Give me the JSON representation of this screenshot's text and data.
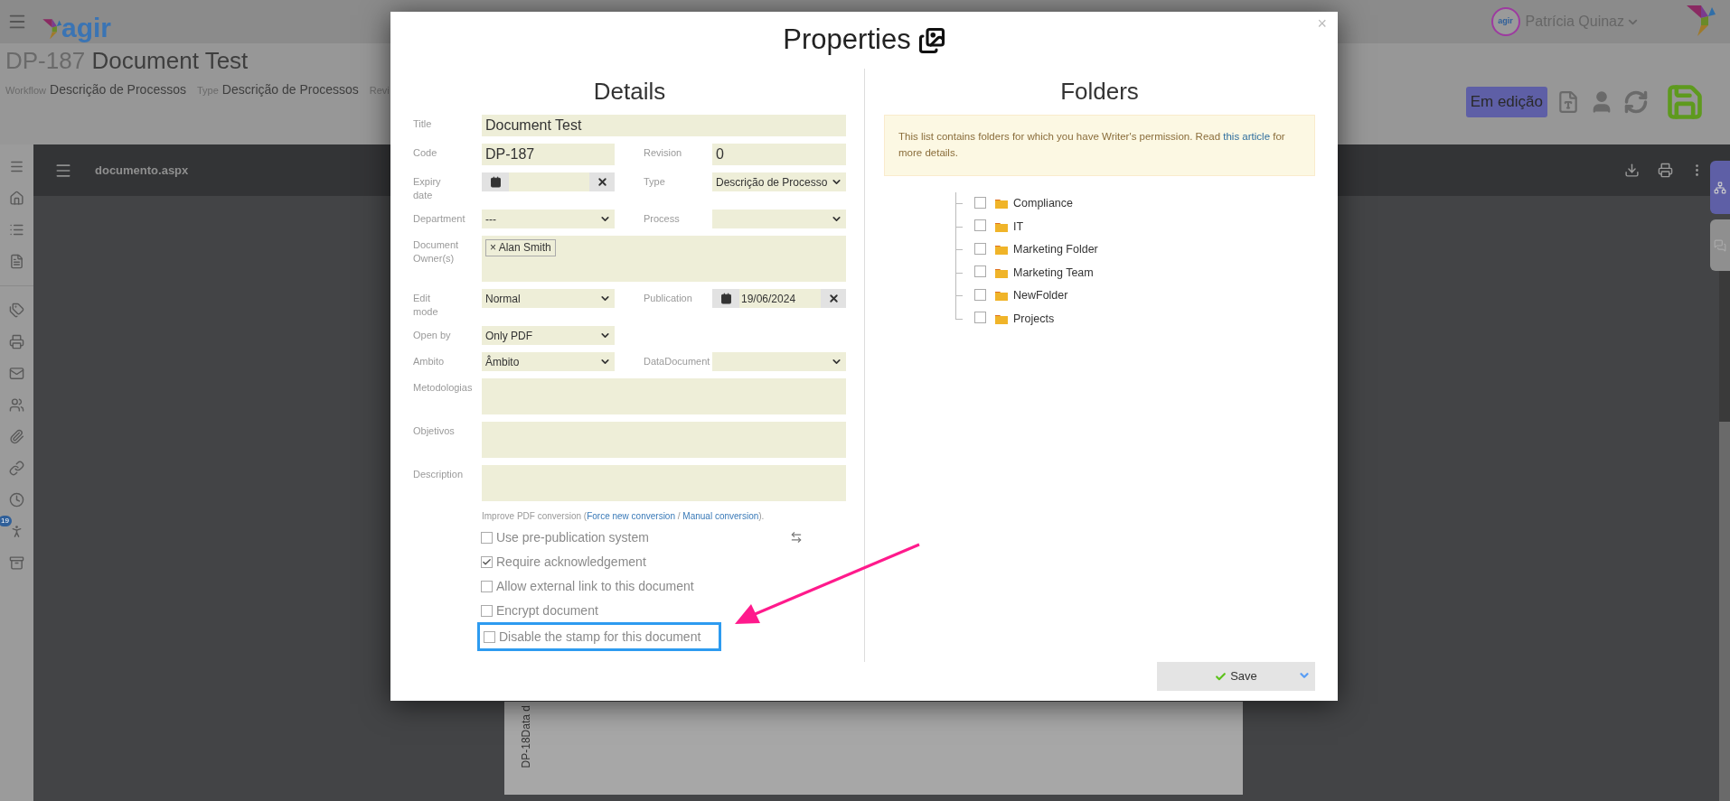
{
  "app_header": {
    "logo_text": "agir",
    "avatar_text": "agir",
    "user_name": "Patrícia Quinaz"
  },
  "document_header": {
    "code": "DP-187",
    "title": "Document Test",
    "meta": [
      {
        "label": "Workflow",
        "value": "Descrição de Processos"
      },
      {
        "label": "Type",
        "value": "Descrição de Processos"
      },
      {
        "label": "Revi"
      }
    ],
    "status_badge": "Em edição"
  },
  "sidebar": {
    "badge": "19"
  },
  "viewer": {
    "file_name": "documento.aspx",
    "page_lines": [
      "DP-18",
      "Data d"
    ]
  },
  "dialog": {
    "title": "Properties",
    "close": "×",
    "details": {
      "heading": "Details",
      "rows": [
        [
          {
            "label_lines": [
              "Title"
            ],
            "kind": "text",
            "value": "Document Test"
          }
        ],
        [
          {
            "label_lines": [
              "Code"
            ],
            "kind": "text",
            "value": "DP-187"
          },
          {
            "label_lines": [
              "Revision"
            ],
            "kind": "text",
            "value": "0"
          }
        ],
        [
          {
            "label_lines": [
              "Expiry",
              "date"
            ],
            "kind": "date"
          },
          {
            "label_lines": [
              "Type"
            ],
            "kind": "select",
            "value": "Descrição de Processo"
          }
        ],
        [
          {
            "label_lines": [
              "Department"
            ],
            "kind": "select",
            "value": "---"
          },
          {
            "label_lines": [
              "Process"
            ],
            "kind": "select"
          }
        ],
        [
          {
            "label_lines": [
              "Document",
              "Owner(s)"
            ],
            "kind": "tags",
            "tags": [
              {
                "remove": "×",
                "name": "Alan Smith"
              }
            ]
          }
        ],
        [
          {
            "label_lines": [
              "Edit",
              "mode"
            ],
            "kind": "select",
            "value": "Normal"
          },
          {
            "label_lines": [
              "Publication"
            ],
            "kind": "date",
            "value": "19/06/2024"
          }
        ],
        [
          {
            "label_lines": [
              "Open by"
            ],
            "kind": "select",
            "value": "Only PDF"
          }
        ],
        [
          {
            "label_lines": [
              "Ambito"
            ],
            "kind": "select",
            "value": "Âmbito"
          },
          {
            "label_lines": [
              "DataDocument"
            ],
            "kind": "select"
          }
        ],
        [
          {
            "label_lines": [
              "Metodologias"
            ],
            "kind": "textarea"
          }
        ],
        [
          {
            "label_lines": [
              "Objetivos"
            ],
            "kind": "textarea"
          }
        ],
        [
          {
            "label_lines": [
              "Description"
            ],
            "kind": "textarea"
          }
        ]
      ],
      "pdf_note": {
        "prefix": "Improve PDF conversion (",
        "link_1": "Force new conversion",
        "separator": " / ",
        "link_2": "Manual conversion",
        "suffix": ")."
      },
      "options": [
        {
          "label": "Use pre-publication system",
          "checked": false,
          "highlighted": false
        },
        {
          "label": "Require acknowledgement",
          "checked": true,
          "highlighted": false
        },
        {
          "label": "Allow external link to this document",
          "checked": false,
          "highlighted": false
        },
        {
          "label": "Encrypt document",
          "checked": false,
          "highlighted": false
        },
        {
          "label": "Disable the stamp for this document",
          "checked": false,
          "highlighted": true
        }
      ]
    },
    "folders": {
      "heading": "Folders",
      "notice": {
        "prefix": "This list contains folders for which you have Writer's permission. Read ",
        "link": "this article",
        "suffix": " for more details."
      },
      "items": [
        {
          "name": "Compliance",
          "checked": false
        },
        {
          "name": "IT",
          "checked": false
        },
        {
          "name": "Marketing Folder",
          "checked": false
        },
        {
          "name": "Marketing Team",
          "checked": false
        },
        {
          "name": "NewFolder",
          "checked": false
        },
        {
          "name": "Projects",
          "checked": false
        }
      ]
    },
    "save_button": "Save"
  }
}
